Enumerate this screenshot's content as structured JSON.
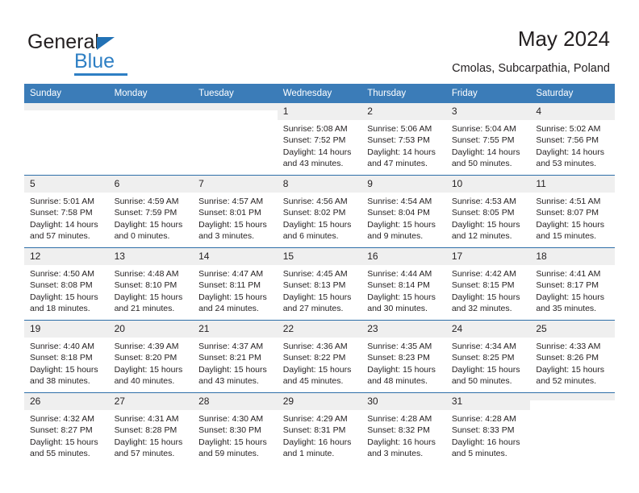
{
  "brand": {
    "name_part1": "General",
    "name_part2": "Blue"
  },
  "header": {
    "title": "May 2024",
    "subtitle": "Cmolas, Subcarpathia, Poland"
  },
  "colors": {
    "header_blue": "#3b7cb8",
    "rule_blue": "#2e6fa8",
    "daynum_bg": "#efefef",
    "brand_blue": "#2e7fc4",
    "text": "#231f20"
  },
  "calendar": {
    "weekday_headers": [
      "Sunday",
      "Monday",
      "Tuesday",
      "Wednesday",
      "Thursday",
      "Friday",
      "Saturday"
    ],
    "weeks": [
      [
        {
          "day": "",
          "empty": true
        },
        {
          "day": "",
          "empty": true
        },
        {
          "day": "",
          "empty": true
        },
        {
          "day": "1",
          "sunrise": "Sunrise: 5:08 AM",
          "sunset": "Sunset: 7:52 PM",
          "daylight_1": "Daylight: 14 hours",
          "daylight_2": "and 43 minutes."
        },
        {
          "day": "2",
          "sunrise": "Sunrise: 5:06 AM",
          "sunset": "Sunset: 7:53 PM",
          "daylight_1": "Daylight: 14 hours",
          "daylight_2": "and 47 minutes."
        },
        {
          "day": "3",
          "sunrise": "Sunrise: 5:04 AM",
          "sunset": "Sunset: 7:55 PM",
          "daylight_1": "Daylight: 14 hours",
          "daylight_2": "and 50 minutes."
        },
        {
          "day": "4",
          "sunrise": "Sunrise: 5:02 AM",
          "sunset": "Sunset: 7:56 PM",
          "daylight_1": "Daylight: 14 hours",
          "daylight_2": "and 53 minutes."
        }
      ],
      [
        {
          "day": "5",
          "sunrise": "Sunrise: 5:01 AM",
          "sunset": "Sunset: 7:58 PM",
          "daylight_1": "Daylight: 14 hours",
          "daylight_2": "and 57 minutes."
        },
        {
          "day": "6",
          "sunrise": "Sunrise: 4:59 AM",
          "sunset": "Sunset: 7:59 PM",
          "daylight_1": "Daylight: 15 hours",
          "daylight_2": "and 0 minutes."
        },
        {
          "day": "7",
          "sunrise": "Sunrise: 4:57 AM",
          "sunset": "Sunset: 8:01 PM",
          "daylight_1": "Daylight: 15 hours",
          "daylight_2": "and 3 minutes."
        },
        {
          "day": "8",
          "sunrise": "Sunrise: 4:56 AM",
          "sunset": "Sunset: 8:02 PM",
          "daylight_1": "Daylight: 15 hours",
          "daylight_2": "and 6 minutes."
        },
        {
          "day": "9",
          "sunrise": "Sunrise: 4:54 AM",
          "sunset": "Sunset: 8:04 PM",
          "daylight_1": "Daylight: 15 hours",
          "daylight_2": "and 9 minutes."
        },
        {
          "day": "10",
          "sunrise": "Sunrise: 4:53 AM",
          "sunset": "Sunset: 8:05 PM",
          "daylight_1": "Daylight: 15 hours",
          "daylight_2": "and 12 minutes."
        },
        {
          "day": "11",
          "sunrise": "Sunrise: 4:51 AM",
          "sunset": "Sunset: 8:07 PM",
          "daylight_1": "Daylight: 15 hours",
          "daylight_2": "and 15 minutes."
        }
      ],
      [
        {
          "day": "12",
          "sunrise": "Sunrise: 4:50 AM",
          "sunset": "Sunset: 8:08 PM",
          "daylight_1": "Daylight: 15 hours",
          "daylight_2": "and 18 minutes."
        },
        {
          "day": "13",
          "sunrise": "Sunrise: 4:48 AM",
          "sunset": "Sunset: 8:10 PM",
          "daylight_1": "Daylight: 15 hours",
          "daylight_2": "and 21 minutes."
        },
        {
          "day": "14",
          "sunrise": "Sunrise: 4:47 AM",
          "sunset": "Sunset: 8:11 PM",
          "daylight_1": "Daylight: 15 hours",
          "daylight_2": "and 24 minutes."
        },
        {
          "day": "15",
          "sunrise": "Sunrise: 4:45 AM",
          "sunset": "Sunset: 8:13 PM",
          "daylight_1": "Daylight: 15 hours",
          "daylight_2": "and 27 minutes."
        },
        {
          "day": "16",
          "sunrise": "Sunrise: 4:44 AM",
          "sunset": "Sunset: 8:14 PM",
          "daylight_1": "Daylight: 15 hours",
          "daylight_2": "and 30 minutes."
        },
        {
          "day": "17",
          "sunrise": "Sunrise: 4:42 AM",
          "sunset": "Sunset: 8:15 PM",
          "daylight_1": "Daylight: 15 hours",
          "daylight_2": "and 32 minutes."
        },
        {
          "day": "18",
          "sunrise": "Sunrise: 4:41 AM",
          "sunset": "Sunset: 8:17 PM",
          "daylight_1": "Daylight: 15 hours",
          "daylight_2": "and 35 minutes."
        }
      ],
      [
        {
          "day": "19",
          "sunrise": "Sunrise: 4:40 AM",
          "sunset": "Sunset: 8:18 PM",
          "daylight_1": "Daylight: 15 hours",
          "daylight_2": "and 38 minutes."
        },
        {
          "day": "20",
          "sunrise": "Sunrise: 4:39 AM",
          "sunset": "Sunset: 8:20 PM",
          "daylight_1": "Daylight: 15 hours",
          "daylight_2": "and 40 minutes."
        },
        {
          "day": "21",
          "sunrise": "Sunrise: 4:37 AM",
          "sunset": "Sunset: 8:21 PM",
          "daylight_1": "Daylight: 15 hours",
          "daylight_2": "and 43 minutes."
        },
        {
          "day": "22",
          "sunrise": "Sunrise: 4:36 AM",
          "sunset": "Sunset: 8:22 PM",
          "daylight_1": "Daylight: 15 hours",
          "daylight_2": "and 45 minutes."
        },
        {
          "day": "23",
          "sunrise": "Sunrise: 4:35 AM",
          "sunset": "Sunset: 8:23 PM",
          "daylight_1": "Daylight: 15 hours",
          "daylight_2": "and 48 minutes."
        },
        {
          "day": "24",
          "sunrise": "Sunrise: 4:34 AM",
          "sunset": "Sunset: 8:25 PM",
          "daylight_1": "Daylight: 15 hours",
          "daylight_2": "and 50 minutes."
        },
        {
          "day": "25",
          "sunrise": "Sunrise: 4:33 AM",
          "sunset": "Sunset: 8:26 PM",
          "daylight_1": "Daylight: 15 hours",
          "daylight_2": "and 52 minutes."
        }
      ],
      [
        {
          "day": "26",
          "sunrise": "Sunrise: 4:32 AM",
          "sunset": "Sunset: 8:27 PM",
          "daylight_1": "Daylight: 15 hours",
          "daylight_2": "and 55 minutes."
        },
        {
          "day": "27",
          "sunrise": "Sunrise: 4:31 AM",
          "sunset": "Sunset: 8:28 PM",
          "daylight_1": "Daylight: 15 hours",
          "daylight_2": "and 57 minutes."
        },
        {
          "day": "28",
          "sunrise": "Sunrise: 4:30 AM",
          "sunset": "Sunset: 8:30 PM",
          "daylight_1": "Daylight: 15 hours",
          "daylight_2": "and 59 minutes."
        },
        {
          "day": "29",
          "sunrise": "Sunrise: 4:29 AM",
          "sunset": "Sunset: 8:31 PM",
          "daylight_1": "Daylight: 16 hours",
          "daylight_2": "and 1 minute."
        },
        {
          "day": "30",
          "sunrise": "Sunrise: 4:28 AM",
          "sunset": "Sunset: 8:32 PM",
          "daylight_1": "Daylight: 16 hours",
          "daylight_2": "and 3 minutes."
        },
        {
          "day": "31",
          "sunrise": "Sunrise: 4:28 AM",
          "sunset": "Sunset: 8:33 PM",
          "daylight_1": "Daylight: 16 hours",
          "daylight_2": "and 5 minutes."
        },
        {
          "day": "",
          "empty": true
        }
      ]
    ]
  }
}
